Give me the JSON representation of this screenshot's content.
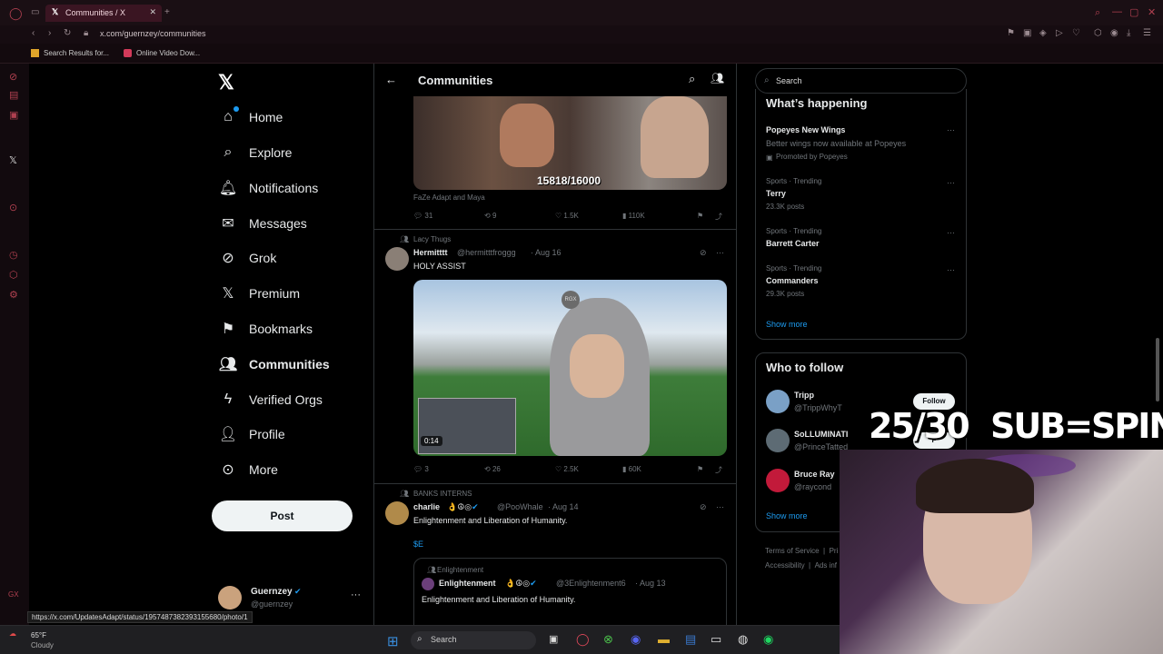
{
  "browser": {
    "tab_title": "Communities / X",
    "address": "x.com/guernzey/communities",
    "bookmarks": [
      "Search Results for...",
      "Online Video Dow..."
    ],
    "status_url": "https://x.com/UpdatesAdapt/status/1957487382393155680/photo/1"
  },
  "nav": {
    "items": [
      {
        "label": "Home",
        "icon": "home-icon"
      },
      {
        "label": "Explore",
        "icon": "search-icon"
      },
      {
        "label": "Notifications",
        "icon": "bell-icon"
      },
      {
        "label": "Messages",
        "icon": "envelope-icon"
      },
      {
        "label": "Grok",
        "icon": "grok-icon"
      },
      {
        "label": "Premium",
        "icon": "x-logo-icon"
      },
      {
        "label": "Bookmarks",
        "icon": "bookmark-icon"
      },
      {
        "label": "Communities",
        "icon": "people-icon"
      },
      {
        "label": "Verified Orgs",
        "icon": "lightning-icon"
      },
      {
        "label": "Profile",
        "icon": "person-icon"
      },
      {
        "label": "More",
        "icon": "more-circle-icon"
      }
    ],
    "post_label": "Post",
    "account_name": "Guernzey",
    "account_handle": "@guernzey"
  },
  "header": {
    "title": "Communities"
  },
  "posts": [
    {
      "overlay_text": "15818/16000",
      "caption": "FaZe Adapt and Maya",
      "replies": "31",
      "reposts": "9",
      "likes": "1.5K",
      "views": "110K"
    },
    {
      "community": "Lacy Thugs",
      "author": "Hermitttt",
      "handle": "@hermitttfroggg",
      "date": "· Aug 16",
      "text": "HOLY ASSIST",
      "video_badge": "RGX",
      "duration": "0:14",
      "replies": "3",
      "reposts": "26",
      "likes": "2.5K",
      "views": "60K"
    },
    {
      "community": "BANKS INTERNS",
      "author": "charlie",
      "handle": "@PooWhale",
      "date": "· Aug 14",
      "text": "Enlightenment and Liberation of Humanity.",
      "tag": "$E",
      "quote": {
        "community": "Enlightenment",
        "author": "Enlightenment",
        "handle": "@3Enlightenment6",
        "date": "· Aug 13",
        "text": "Enlightenment and Liberation of Humanity."
      }
    }
  ],
  "sidebar": {
    "search_placeholder": "Search",
    "happening_title": "What’s happening",
    "trends": [
      {
        "meta": "",
        "title": "Popeyes New Wings",
        "sub": "Better wings now available at Popeyes",
        "promo": "Promoted by Popeyes"
      },
      {
        "meta": "Sports · Trending",
        "title": "Terry",
        "sub": "23.3K posts"
      },
      {
        "meta": "Sports · Trending",
        "title": "Barrett Carter",
        "sub": ""
      },
      {
        "meta": "Sports · Trending",
        "title": "Commanders",
        "sub": "29.3K posts"
      }
    ],
    "show_more": "Show more",
    "follow_title": "Who to follow",
    "follow": [
      {
        "name": "Tripp",
        "handle": "@TrippWhyT",
        "button": "Follow"
      },
      {
        "name": "SoLLUMINATI",
        "handle": "@PrinceTatted",
        "button": "F"
      },
      {
        "name": "Bruce Ray",
        "handle": "@raycond",
        "button": ""
      }
    ],
    "show_more_2": "Show more",
    "footer": [
      "Terms of Service",
      "|",
      "Pri",
      "Accessibility",
      "|",
      "Ads inf"
    ]
  },
  "stream_overlay": {
    "counter": "25/30",
    "promo": "SUB=SPIN"
  },
  "taskbar": {
    "temp": "65°F",
    "weather": "Cloudy",
    "search": "Search"
  },
  "colors": {
    "accent": "#1d9bf0",
    "opera_red": "#b04050",
    "background": "#000000",
    "border": "#2f3336"
  }
}
